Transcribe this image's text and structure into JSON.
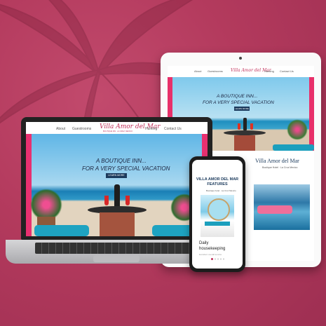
{
  "laptop": {
    "brand": "Villa Amor del Mar",
    "brand_sub": "BOUTIQUE INN · LA CRUZ, MEXICO",
    "nav": [
      "About",
      "Guestrooms",
      "Hunting",
      "Contact Us"
    ],
    "hero_line1": "A BOUTIQUE INN...",
    "hero_line2": "FOR A VERY SPECIAL VACATION",
    "hero_button": "LEARN MORE"
  },
  "tablet": {
    "brand": "Villa Amor del Mar",
    "nav": [
      "About",
      "Guestrooms",
      "Hunting",
      "Contact Us"
    ],
    "hero_line1": "A BOUTIQUE INN...",
    "hero_line2": "FOR A VERY SPECIAL VACATION",
    "hero_button": "LEARN MORE",
    "section_title": "Villa Amor del Mar",
    "section_sub": "Boutique Hotel · La Cruz Mexico"
  },
  "phone": {
    "title_line1": "VILLA AMOR DEL MAR",
    "title_line2": "FEATURES",
    "subtitle": "Boutique hotel · La Cruz Mexico",
    "caption_line1": "Daily",
    "caption_line2": "housekeeping",
    "caption_sub": "Excellent overall service"
  },
  "colors": {
    "background": "#b8395e",
    "brand": "#c0305a",
    "navy": "#1b3a5c",
    "pool": "#1ea3c1"
  }
}
